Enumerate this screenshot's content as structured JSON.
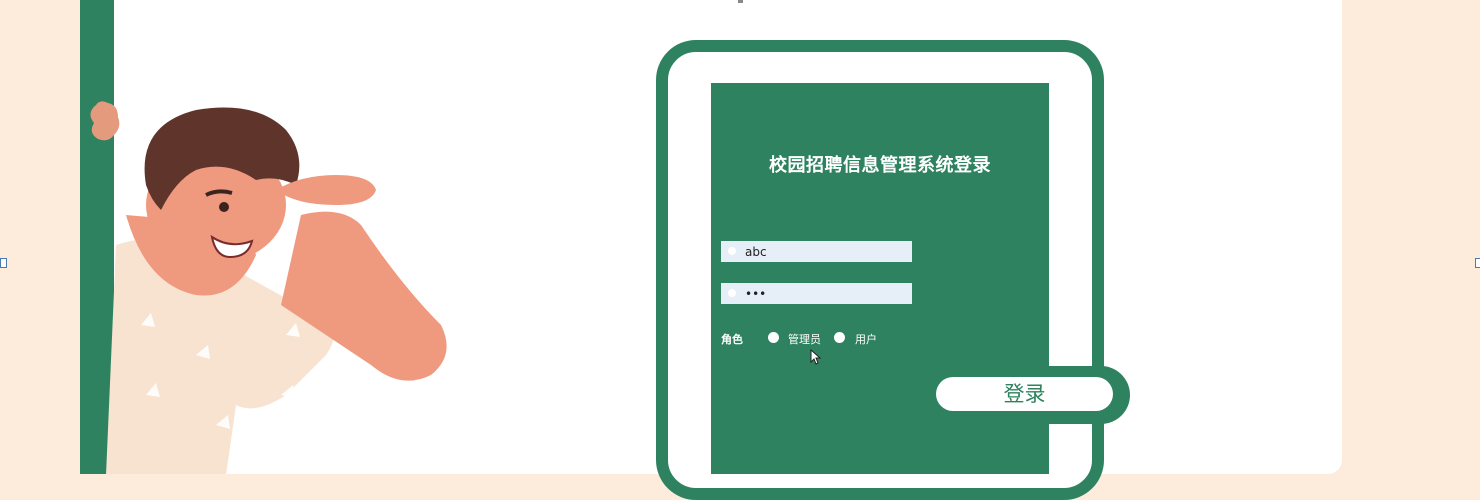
{
  "login": {
    "title": "校园招聘信息管理系统登录",
    "username_value": "abc",
    "password_value": "•••",
    "role_label": "角色",
    "role_options": [
      "管理员",
      "用户"
    ],
    "login_button": "登录"
  },
  "colors": {
    "brand_green": "#2e8260",
    "page_background": "#fdebdc",
    "input_background": "#e6eff8"
  },
  "icons": [
    "user-icon",
    "lock-icon",
    "pointer-cursor-icon"
  ]
}
